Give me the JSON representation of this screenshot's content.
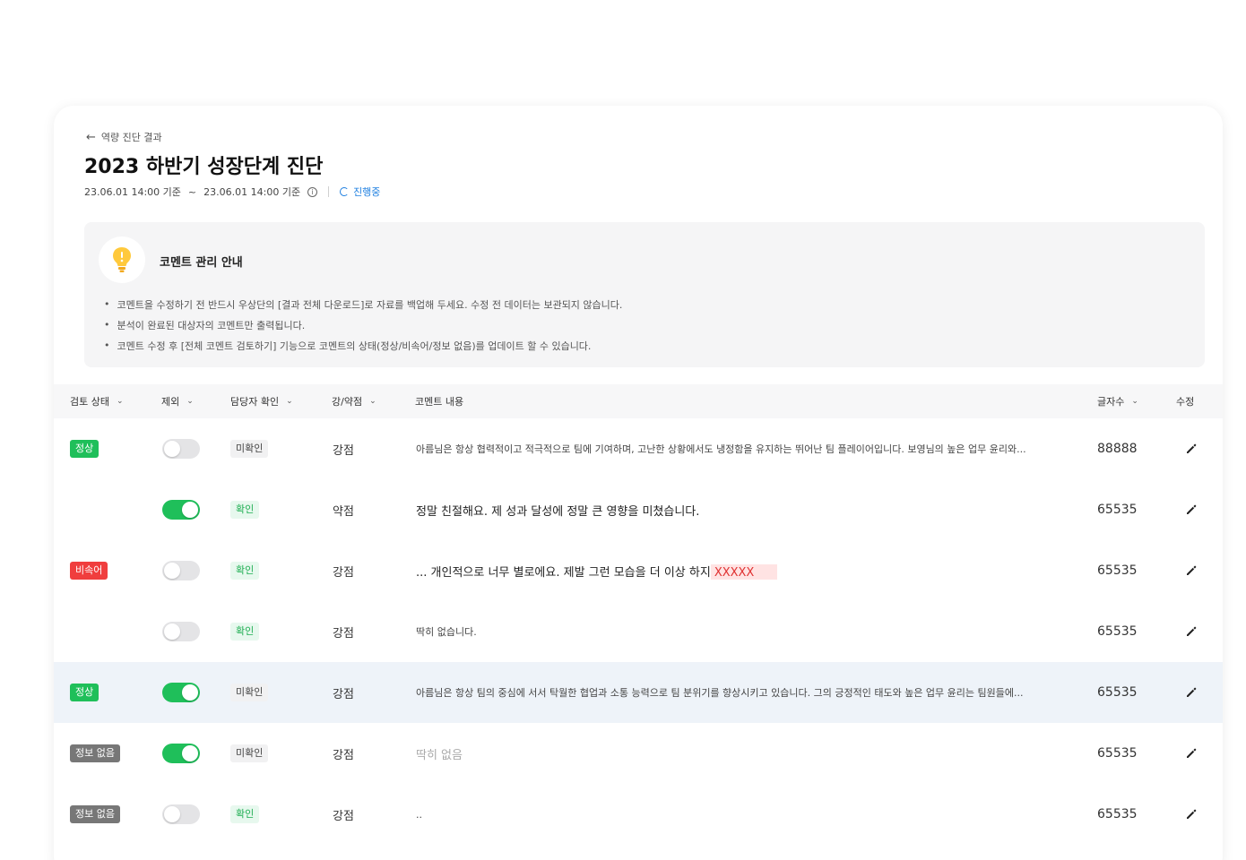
{
  "header": {
    "back_label": "역량 진단 결과",
    "title": "2023 하반기 성장단계 진단",
    "date_from": "23.06.01 14:00 기준",
    "date_sep": "~",
    "date_to": "23.06.01 14:00 기준",
    "status": "진행중"
  },
  "notice": {
    "title": "코멘트 관리 안내",
    "items": [
      "코멘트을 수정하기 전 반드시 우상단의 [결과 전체 다운로드]로 자료를 백업해 두세요. 수정 전 데이터는 보관되지 않습니다.",
      "분석이 완료된 대상자의 코멘트만 출력됩니다.",
      "코멘트 수정 후 [전체 코멘트 검토하기] 기능으로 코멘트의 상태(정상/비속어/정보 없음)를 업데이트 할 수 있습니다."
    ]
  },
  "table": {
    "headers": {
      "review_status": "검토 상태",
      "exclude": "제외",
      "owner_check": "담당자 확인",
      "strength": "강/약점",
      "comment": "코멘트 내용",
      "length": "글자수",
      "edit": "수정"
    },
    "rows": [
      {
        "status": "정상",
        "status_type": "normal",
        "excluded": false,
        "check": "미확인",
        "check_type": "unchecked",
        "kind": "강점",
        "comment": "아름님은 항상 협력적이고 적극적으로 팀에 기여하며, 고난한 상황에서도 냉정함을 유지하는 뛰어난 팀 플레이어입니다. 보영님의 높은 업무 윤리와...",
        "count": "88888"
      },
      {
        "status": "",
        "status_type": "",
        "excluded": true,
        "check": "확인",
        "check_type": "checked",
        "kind": "약점",
        "comment": "정말 친절해요. 제 성과 달성에 정말 큰 영향을 미쳤습니다.",
        "count": "65535"
      },
      {
        "status": "비속어",
        "status_type": "abuse",
        "excluded": false,
        "check": "확인",
        "check_type": "checked",
        "kind": "강점",
        "comment": "... 개인적으로 너무 별로에요. 제발 그런 모습을 더 이상 하지",
        "masked": "XXXXX",
        "count": "65535"
      },
      {
        "status": "",
        "status_type": "",
        "excluded": false,
        "check": "확인",
        "check_type": "checked",
        "kind": "강점",
        "comment": "딱히 없습니다.",
        "count": "65535"
      },
      {
        "status": "정상",
        "status_type": "normal",
        "excluded": true,
        "check": "미확인",
        "check_type": "unchecked",
        "kind": "강점",
        "comment": "아름님은 항상 팀의 중심에 서서 탁월한 협업과 소통 능력으로 팀 분위기를 향상시키고 있습니다. 그의 긍정적인 태도와 높은 업무 윤리는 팀원들에...",
        "count": "65535"
      },
      {
        "status": "정보 없음",
        "status_type": "none",
        "excluded": true,
        "check": "미확인",
        "check_type": "unchecked",
        "kind": "강점",
        "comment": "딱히 없음",
        "count": "65535"
      },
      {
        "status": "정보 없음",
        "status_type": "none",
        "excluded": false,
        "check": "확인",
        "check_type": "checked",
        "kind": "강점",
        "comment": "..",
        "count": "65535"
      }
    ]
  },
  "colors": {
    "accent_green": "#1fbf5a",
    "abuse_red": "#f03e3e",
    "info_gray": "#777777",
    "link_blue": "#1e7fe0",
    "highlight_row": "#eef3f9"
  },
  "icons": [
    "arrow-left-icon",
    "info-icon",
    "spinner-icon",
    "lightbulb-icon",
    "chevron-down-icon",
    "pencil-icon"
  ]
}
